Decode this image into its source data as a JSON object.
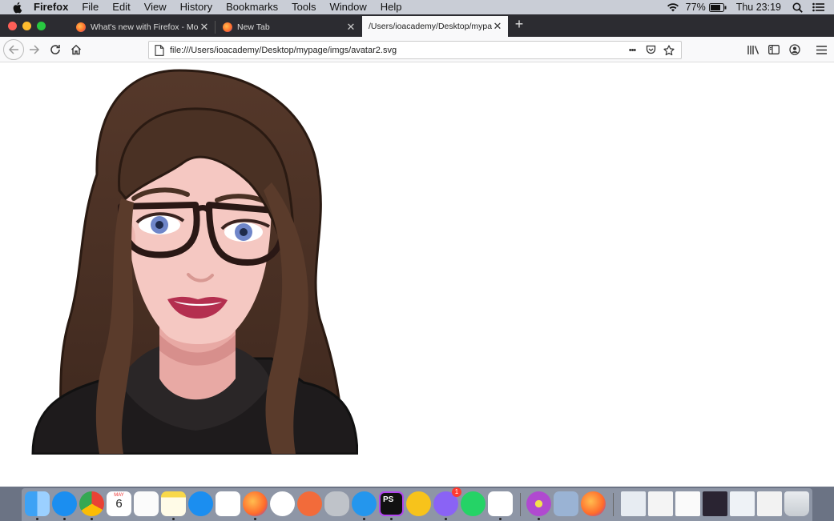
{
  "menubar": {
    "app_name": "Firefox",
    "items": [
      "File",
      "Edit",
      "View",
      "History",
      "Bookmarks",
      "Tools",
      "Window",
      "Help"
    ],
    "battery": "77%",
    "clock": "Thu 23:19"
  },
  "tabs": [
    {
      "title": "What's new with Firefox - More"
    },
    {
      "title": "New Tab"
    },
    {
      "title": "/Users/ioacademy/Desktop/mypage"
    }
  ],
  "toolbar": {
    "url": "file:///Users/ioacademy/Desktop/mypage/imgs/avatar2.svg",
    "more_label": "•••"
  },
  "dock": {
    "calendar_month": "MAY",
    "calendar_day": "6",
    "ps_label": "PS",
    "messenger_badge": "1"
  },
  "colors": {
    "hair": "#4a3124",
    "skin": "#f5c8c2",
    "hoodie": "#1e1b1c",
    "eye": "#6f86c9",
    "lips": "#b42f4f"
  }
}
